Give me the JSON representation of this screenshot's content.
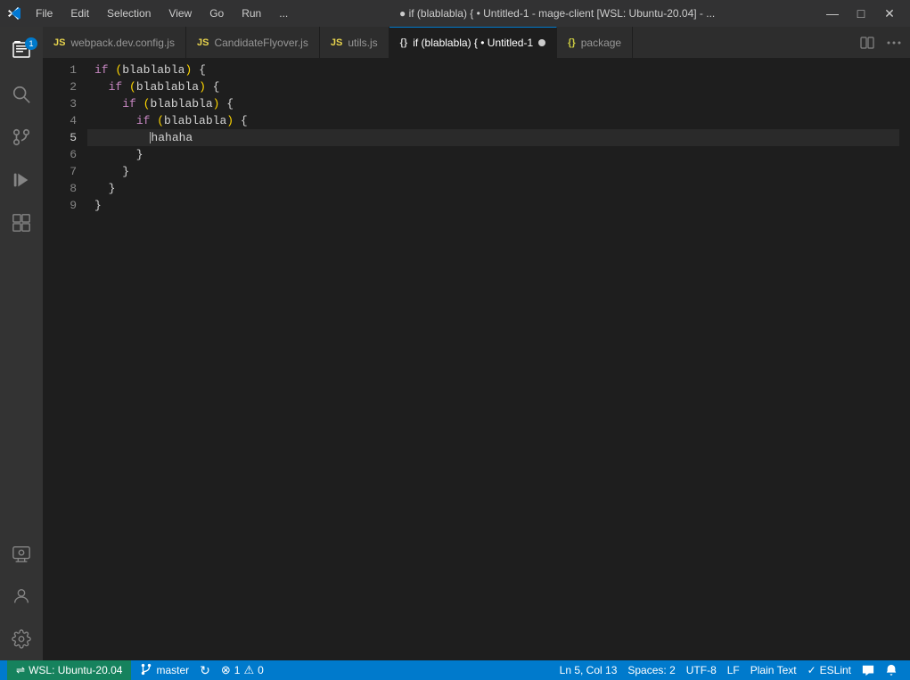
{
  "titleBar": {
    "title": "● if (blablabla) { • Untitled-1 - mage-client [WSL: Ubuntu-20.04] - ...",
    "menus": [
      "File",
      "Edit",
      "Selection",
      "View",
      "Go",
      "Run",
      "..."
    ],
    "controls": [
      "—",
      "□",
      "✕"
    ]
  },
  "activityBar": {
    "icons": [
      {
        "name": "explorer-icon",
        "symbol": "⬜",
        "active": true,
        "badge": "1"
      },
      {
        "name": "search-icon",
        "symbol": "🔍",
        "active": false
      },
      {
        "name": "source-control-icon",
        "symbol": "⑂",
        "active": false
      },
      {
        "name": "run-debug-icon",
        "symbol": "▷",
        "active": false
      },
      {
        "name": "extensions-icon",
        "symbol": "⊞",
        "active": false
      },
      {
        "name": "remote-explorer-icon",
        "symbol": "🖥",
        "active": false
      }
    ],
    "bottomIcons": [
      {
        "name": "accounts-icon",
        "symbol": "👤"
      },
      {
        "name": "settings-icon",
        "symbol": "⚙"
      }
    ]
  },
  "tabs": [
    {
      "id": "webpack",
      "icon": "JS",
      "iconType": "js",
      "label": "webpack.dev.config.js",
      "active": false,
      "modified": false
    },
    {
      "id": "candidate",
      "icon": "JS",
      "iconType": "js",
      "label": "CandidateFlyover.js",
      "active": false,
      "modified": false
    },
    {
      "id": "utils",
      "icon": "JS",
      "iconType": "js",
      "label": "utils.js",
      "active": false,
      "modified": false
    },
    {
      "id": "untitled",
      "icon": "{}",
      "iconType": "bracket",
      "label": "if (blablabla) {",
      "sublabel": "Untitled-1",
      "active": true,
      "modified": true
    },
    {
      "id": "package",
      "icon": "{}",
      "iconType": "json",
      "label": "package",
      "active": false,
      "modified": false
    }
  ],
  "codeLines": [
    {
      "num": 1,
      "text": "if (blablabla) {",
      "indent": 0
    },
    {
      "num": 2,
      "text": "  if (blablabla) {",
      "indent": 1
    },
    {
      "num": 3,
      "text": "    if (blablabla) {",
      "indent": 2
    },
    {
      "num": 4,
      "text": "      if (blablabla) {",
      "indent": 3
    },
    {
      "num": 5,
      "text": "        hahaha",
      "indent": 4,
      "active": true
    },
    {
      "num": 6,
      "text": "      }",
      "indent": 3
    },
    {
      "num": 7,
      "text": "    }",
      "indent": 2
    },
    {
      "num": 8,
      "text": "  }",
      "indent": 1
    },
    {
      "num": 9,
      "text": "}",
      "indent": 0
    }
  ],
  "statusBar": {
    "wslLabel": "WSL: Ubuntu-20.04",
    "branchIcon": "⑂",
    "branchLabel": "master",
    "syncIcon": "↻",
    "errorIcon": "⊗",
    "errorCount": "1",
    "warningIcon": "⚠",
    "warningCount": "0",
    "position": "Ln 5, Col 13",
    "spaces": "Spaces: 2",
    "encoding": "UTF-8",
    "lineEnding": "LF",
    "language": "Plain Text",
    "eslintIcon": "✓",
    "eslintLabel": "ESLint",
    "notifIcon": "🔔",
    "remoteIcon": "🖥"
  }
}
